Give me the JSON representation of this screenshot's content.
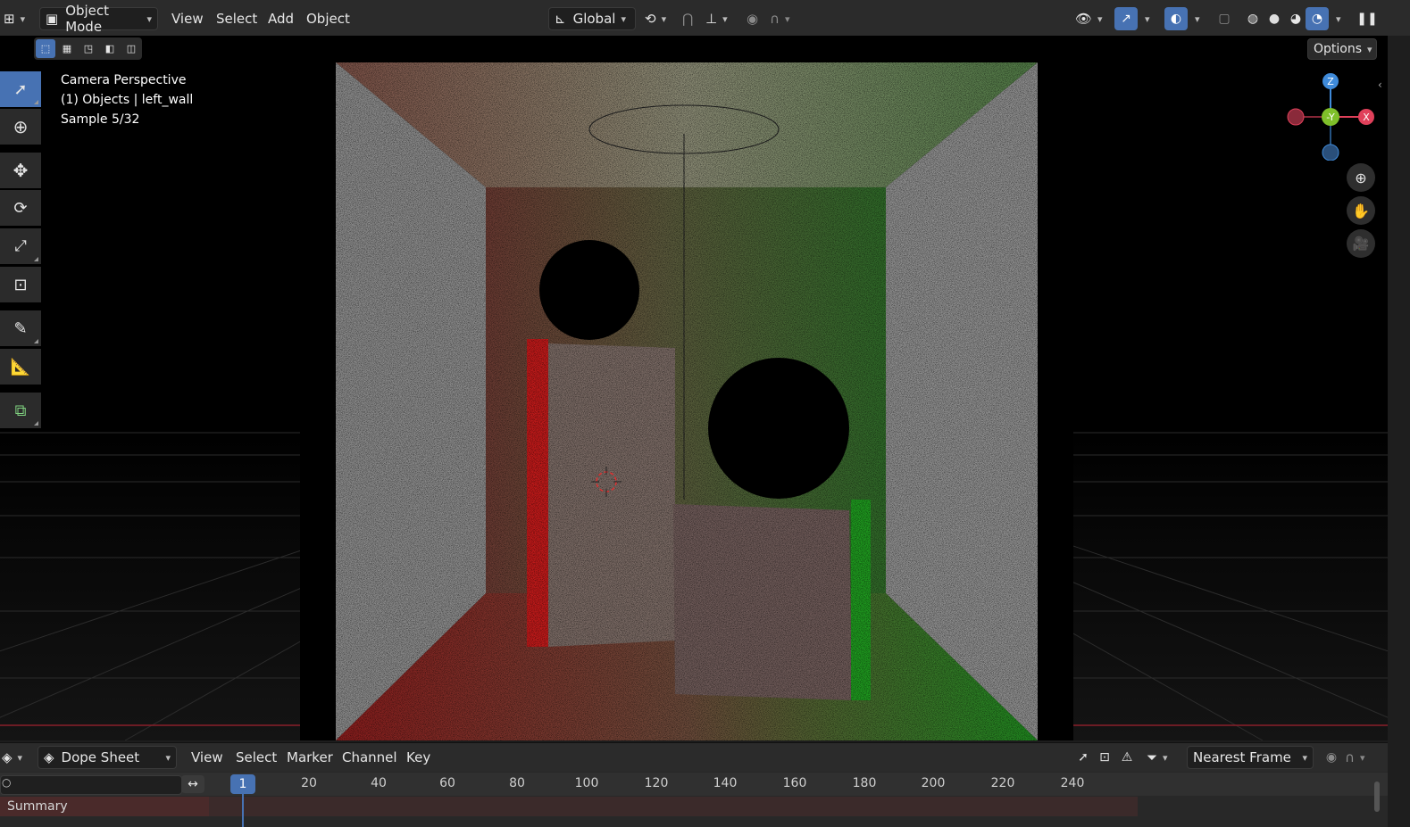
{
  "header": {
    "mode": "Object Mode",
    "menu": [
      "View",
      "Select",
      "Add",
      "Object"
    ],
    "transform_orientation": "Global",
    "options_label": "Options"
  },
  "viewport": {
    "overlay_lines": [
      "Camera Perspective",
      "(1) Objects | left_wall",
      "Sample 5/32"
    ],
    "gizmo_axes": [
      "Z",
      "-Y",
      "X"
    ]
  },
  "dopesheet": {
    "editor": "Dope Sheet",
    "menu": [
      "View",
      "Select",
      "Marker",
      "Channel",
      "Key"
    ],
    "snap": "Nearest Frame",
    "current_frame": "1",
    "ticks": [
      "20",
      "40",
      "60",
      "80",
      "100",
      "120",
      "140",
      "160",
      "180",
      "200",
      "220",
      "240"
    ],
    "summary": "Summary"
  },
  "colors": {
    "accent": "#4772b3",
    "x_axis": "#e0405a",
    "y_axis": "#7fbf2a",
    "z_axis": "#3f8ad9"
  }
}
